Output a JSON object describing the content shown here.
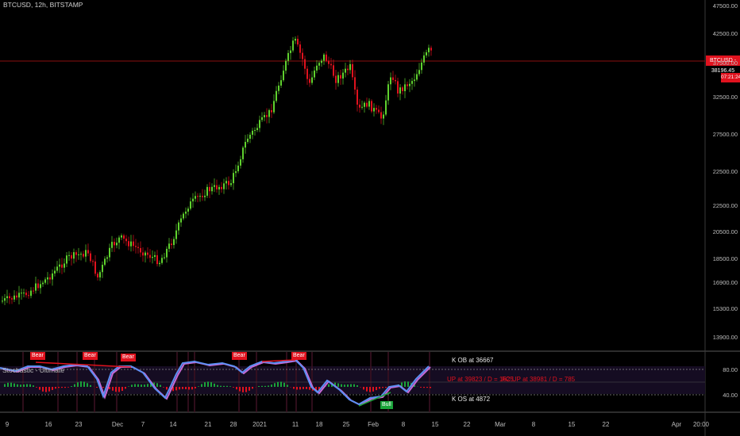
{
  "header": {
    "title": "BTCUSD, 12h, BITSTAMP"
  },
  "price_tag": {
    "value": "BTCUSD - 38196.45",
    "countdown": "07:21:24"
  },
  "y_axis": [
    "47500.00",
    "42500.00",
    "37500.00",
    "32500.00",
    "27500.00",
    "22500.00",
    "22500.00",
    "20500.00",
    "18500.00",
    "16900.00",
    "15300.00",
    "13900.00"
  ],
  "x_axis": [
    "9",
    "16",
    "23",
    "Dec",
    "7",
    "14",
    "21",
    "28",
    "2021",
    "11",
    "18",
    "25",
    "Feb",
    "8",
    "15",
    "22",
    "Mar",
    "8",
    "15",
    "22",
    "Apr",
    "20:00"
  ],
  "indicator": {
    "title": "Stochastic - Ultimate",
    "levels": [
      "80.00",
      "40.00"
    ],
    "ob_text": "K OB at 36667",
    "os_text": "K OS at 4872",
    "up_text": "UP at 39823 / D = 1625",
    "fc_text": "FC UP at 38981 / D = 785",
    "bear_label": "Bear",
    "bull_label": "Bull"
  },
  "colors": {
    "up_candle": "#5fd12e",
    "down_candle": "#e0121e",
    "k_line": "#5b8ff2",
    "d_line": "#c76ad6",
    "price_line": "#8c1010"
  }
}
